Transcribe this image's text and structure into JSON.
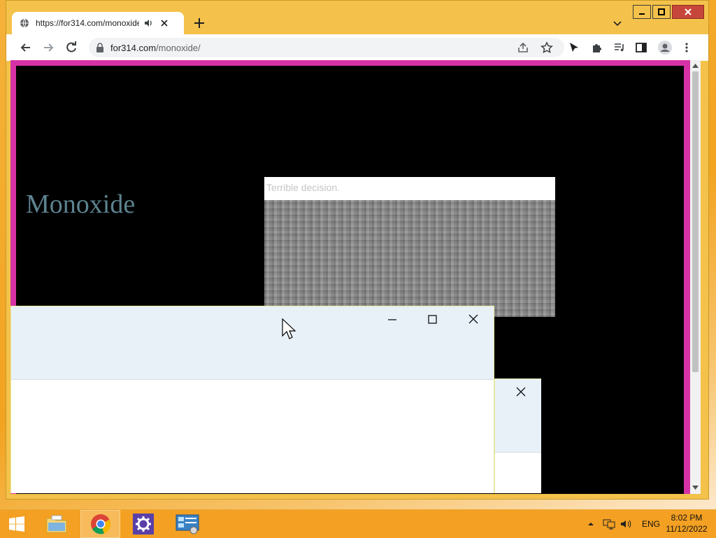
{
  "browser": {
    "tab_title": "https://for314.com/monoxide",
    "url_host": "for314.com",
    "url_path": "/monoxide/"
  },
  "page": {
    "site_title": "Monoxide"
  },
  "popup": {
    "title": "Terrible decision."
  },
  "taskbar": {
    "language": "ENG",
    "time": "8:02 PM",
    "date": "11/12/2022"
  },
  "colors": {
    "page_border": "#d632a6",
    "title_color": "#5d8390",
    "taskbar": "#f3a023"
  }
}
